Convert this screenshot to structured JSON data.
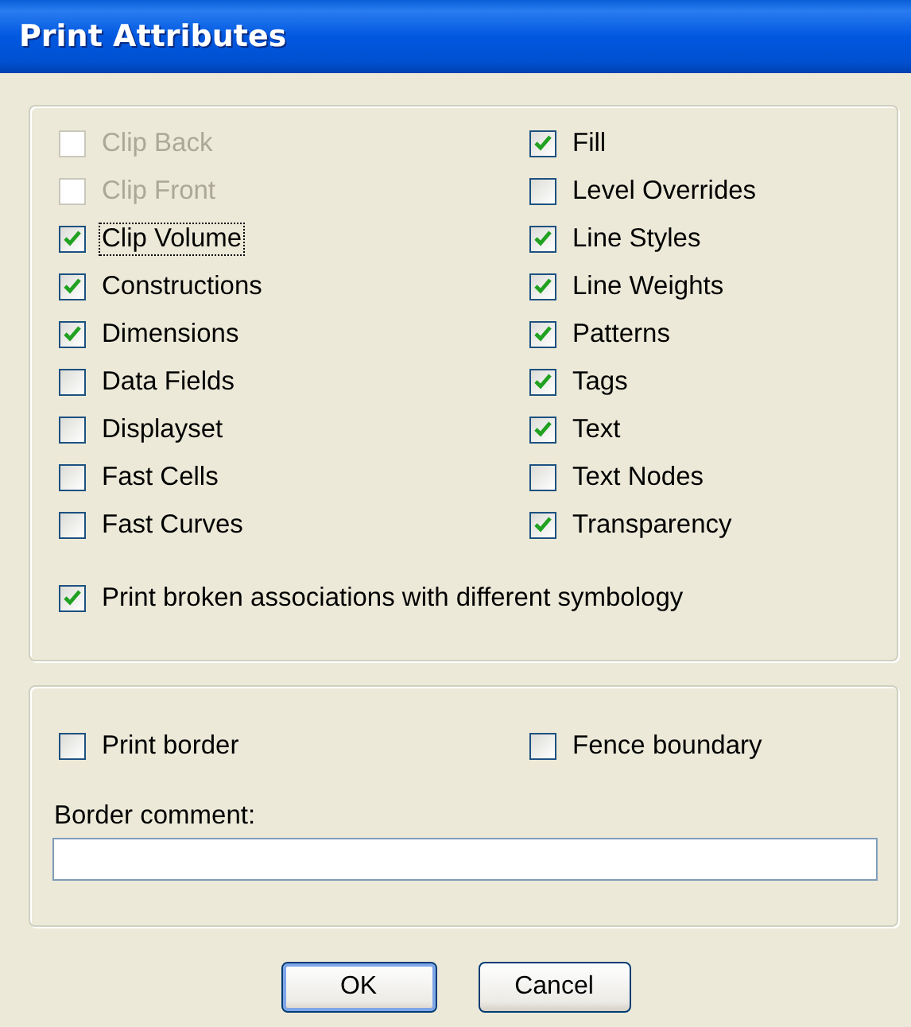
{
  "window": {
    "title": "Print Attributes"
  },
  "attributes": {
    "left": [
      {
        "label": "Clip Back",
        "checked": false,
        "disabled": true,
        "focused": false
      },
      {
        "label": "Clip Front",
        "checked": false,
        "disabled": true,
        "focused": false
      },
      {
        "label": "Clip Volume",
        "checked": true,
        "disabled": false,
        "focused": true
      },
      {
        "label": "Constructions",
        "checked": true,
        "disabled": false,
        "focused": false
      },
      {
        "label": "Dimensions",
        "checked": true,
        "disabled": false,
        "focused": false
      },
      {
        "label": "Data Fields",
        "checked": false,
        "disabled": false,
        "focused": false
      },
      {
        "label": "Displayset",
        "checked": false,
        "disabled": false,
        "focused": false
      },
      {
        "label": "Fast Cells",
        "checked": false,
        "disabled": false,
        "focused": false
      },
      {
        "label": "Fast Curves",
        "checked": false,
        "disabled": false,
        "focused": false
      }
    ],
    "right": [
      {
        "label": "Fill",
        "checked": true,
        "disabled": false,
        "focused": false
      },
      {
        "label": "Level Overrides",
        "checked": false,
        "disabled": false,
        "focused": false
      },
      {
        "label": "Line Styles",
        "checked": true,
        "disabled": false,
        "focused": false
      },
      {
        "label": "Line Weights",
        "checked": true,
        "disabled": false,
        "focused": false
      },
      {
        "label": "Patterns",
        "checked": true,
        "disabled": false,
        "focused": false
      },
      {
        "label": "Tags",
        "checked": true,
        "disabled": false,
        "focused": false
      },
      {
        "label": "Text",
        "checked": true,
        "disabled": false,
        "focused": false
      },
      {
        "label": "Text Nodes",
        "checked": false,
        "disabled": false,
        "focused": false
      },
      {
        "label": "Transparency",
        "checked": true,
        "disabled": false,
        "focused": false
      }
    ],
    "broken_associations": {
      "label": "Print broken associations with different symbology",
      "checked": true,
      "disabled": false,
      "focused": false
    }
  },
  "border": {
    "options": [
      {
        "label": "Print border",
        "checked": false,
        "disabled": false,
        "focused": false
      },
      {
        "label": "Fence boundary",
        "checked": false,
        "disabled": false,
        "focused": false
      }
    ],
    "comment_label": {
      "label": "Border comment:"
    }
  },
  "buttons": [
    {
      "label": "OK",
      "default": true
    },
    {
      "label": "Cancel",
      "default": false
    }
  ]
}
